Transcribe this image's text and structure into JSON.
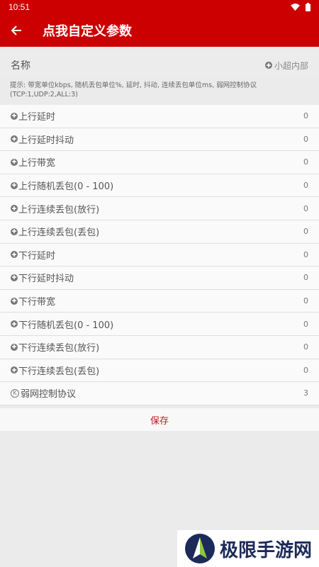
{
  "status": {
    "time": "10:51"
  },
  "appbar": {
    "title": "点我自定义参数"
  },
  "name_row": {
    "label": "名称",
    "value": "小超内部"
  },
  "hint": "提示: 带宽单位kbps, 随机丢包单位%, 延时, 抖动, 连续丢包单位ms, 弱网控制协议(TCP:1,UDP:2,ALL:3)",
  "rows": [
    {
      "label": "上行延时",
      "value": "0"
    },
    {
      "label": "上行延时抖动",
      "value": "0"
    },
    {
      "label": "上行带宽",
      "value": "0"
    },
    {
      "label": "上行随机丢包(0 - 100)",
      "value": "0"
    },
    {
      "label": "上行连续丢包(放行)",
      "value": "0"
    },
    {
      "label": "上行连续丢包(丢包)",
      "value": "0"
    },
    {
      "label": "下行延时",
      "value": "0"
    },
    {
      "label": "下行延时抖动",
      "value": "0"
    },
    {
      "label": "下行带宽",
      "value": "0"
    },
    {
      "label": "下行随机丢包(0 - 100)",
      "value": "0"
    },
    {
      "label": "下行连续丢包(放行)",
      "value": "0"
    },
    {
      "label": "下行连续丢包(丢包)",
      "value": "0"
    },
    {
      "label": "弱网控制协议",
      "value": "3"
    }
  ],
  "save_label": "保存",
  "watermark": "极限手游网",
  "colors": {
    "accent": "#cc0000",
    "save_text": "#b71c1c"
  }
}
